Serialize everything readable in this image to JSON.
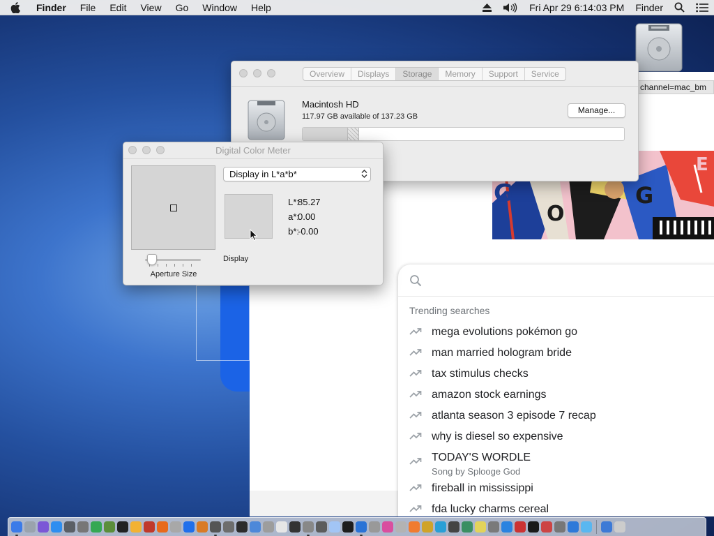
{
  "menubar": {
    "app_name": "Finder",
    "items": [
      "File",
      "Edit",
      "View",
      "Go",
      "Window",
      "Help"
    ],
    "datetime": "Fri Apr 29  6:14:03 PM",
    "right_app": "Finder"
  },
  "about_window": {
    "tabs": [
      "Overview",
      "Displays",
      "Storage",
      "Memory",
      "Support",
      "Service"
    ],
    "active_tab": "Storage",
    "disk_name": "Macintosh HD",
    "disk_available": "117.97 GB available of 137.23 GB",
    "manage_label": "Manage...",
    "used_fraction": 0.14
  },
  "color_meter": {
    "title": "Digital Color Meter",
    "display_mode": "Display in L*a*b*",
    "values": [
      {
        "key": "L*:",
        "value": "85.27"
      },
      {
        "key": "a*:",
        "value": "0.00"
      },
      {
        "key": "b*:",
        "value": "-0.00"
      }
    ],
    "aperture_label": "Aperture Size",
    "display_label": "Display",
    "swatch_color": "#d6d6d6"
  },
  "browser": {
    "url_fragment": "channel=mac_bm",
    "trending_title": "Trending searches",
    "trends": [
      {
        "text": "mega evolutions pokémon go"
      },
      {
        "text": "man married hologram bride"
      },
      {
        "text": "tax stimulus checks"
      },
      {
        "text": "amazon stock earnings"
      },
      {
        "text": "atlanta season 3 episode 7 recap"
      },
      {
        "text": "why is diesel so expensive"
      },
      {
        "text": "TODAY'S WORDLE",
        "sub": "Song by Splooge God"
      },
      {
        "text": "fireball in mississippi"
      },
      {
        "text": "fda lucky charms cereal"
      }
    ]
  },
  "colors": {
    "accent_blue": "#1b63e6",
    "window_bg": "#ececec",
    "trend_text": "#202124",
    "muted_text": "#70757a"
  }
}
